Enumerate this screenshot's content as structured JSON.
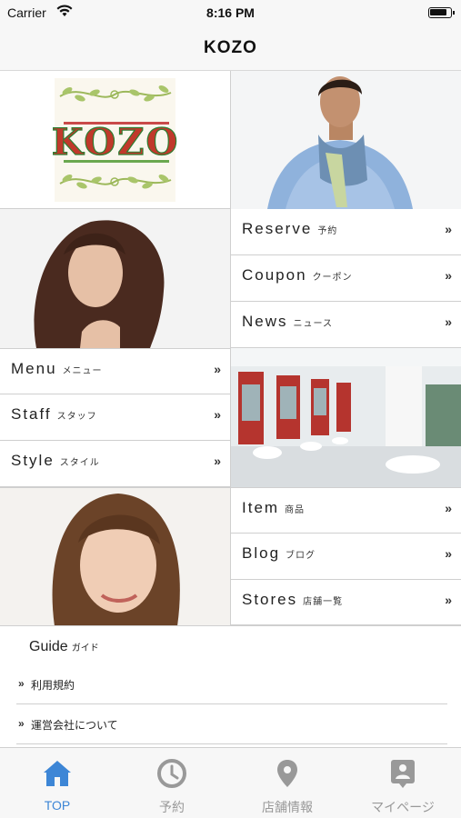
{
  "status_bar": {
    "carrier": "Carrier",
    "time": "8:16 PM"
  },
  "nav": {
    "title": "KOZO"
  },
  "logo": {
    "text": "KOZO"
  },
  "menu": {
    "reserve": {
      "en": "Reserve",
      "jp": "予約"
    },
    "coupon": {
      "en": "Coupon",
      "jp": "クーポン"
    },
    "news": {
      "en": "News",
      "jp": "ニュース"
    },
    "menu": {
      "en": "Menu",
      "jp": "メニュー"
    },
    "staff": {
      "en": "Staff",
      "jp": "スタッフ"
    },
    "style": {
      "en": "Style",
      "jp": "スタイル"
    },
    "item": {
      "en": "Item",
      "jp": "商品"
    },
    "blog": {
      "en": "Blog",
      "jp": "ブログ"
    },
    "stores": {
      "en": "Stores",
      "jp": "店舗一覧"
    },
    "chevron": "»"
  },
  "guide": {
    "title": "Guide",
    "title_jp": "ガイド",
    "items": [
      {
        "label": "利用規約"
      },
      {
        "label": "運営会社について"
      }
    ]
  },
  "tabbar": {
    "tabs": [
      {
        "label": "TOP",
        "icon": "home-icon",
        "active": true
      },
      {
        "label": "予約",
        "icon": "clock-icon",
        "active": false
      },
      {
        "label": "店舗情報",
        "icon": "location-pin-icon",
        "active": false
      },
      {
        "label": "マイページ",
        "icon": "person-badge-icon",
        "active": false
      }
    ],
    "active_color": "#3d86d6",
    "inactive_color": "#999999"
  }
}
